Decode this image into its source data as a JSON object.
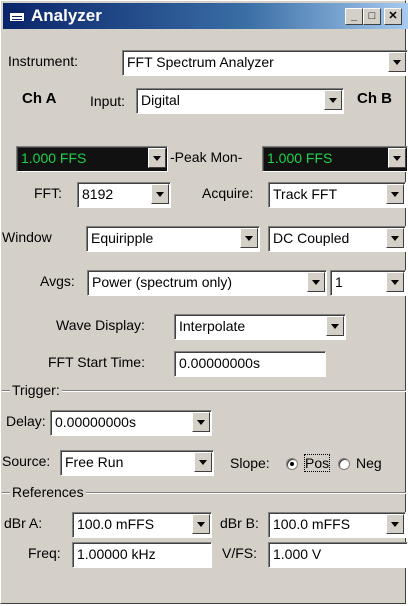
{
  "window": {
    "title": "Analyzer",
    "minimize": "_",
    "maximize": "□",
    "close": "✕"
  },
  "instrument": {
    "label": "Instrument:",
    "value": "FFT Spectrum Analyzer"
  },
  "channels": {
    "ch_a": "Ch A",
    "ch_b": "Ch B",
    "input_label": "Input:",
    "input_value": "Digital"
  },
  "peak": {
    "left_value": "1.000   FFS",
    "label": "-Peak Mon-",
    "right_value": "1.000   FFS"
  },
  "fft": {
    "label": "FFT:",
    "value": "8192",
    "acquire_label": "Acquire:",
    "acquire_value": "Track FFT"
  },
  "window_row": {
    "label": "Window",
    "value": "Equiripple",
    "coupling": "DC Coupled"
  },
  "avgs": {
    "label": "Avgs:",
    "value": "Power (spectrum only)",
    "count": "1"
  },
  "wave_display": {
    "label": "Wave Display:",
    "value": "Interpolate"
  },
  "fft_start": {
    "label": "FFT Start Time:",
    "value": "0.00000000s"
  },
  "trigger": {
    "group_label": "Trigger:",
    "delay_label": "Delay:",
    "delay_value": "0.00000000s",
    "source_label": "Source:",
    "source_value": "Free Run",
    "slope_label": "Slope:",
    "pos_label": "Pos",
    "neg_label": "Neg",
    "slope_selected": "Pos"
  },
  "references": {
    "group_label": "References",
    "dbr_a_label": "dBr A:",
    "dbr_a_value": "100.0   mFFS",
    "dbr_b_label": "dBr B:",
    "dbr_b_value": "100.0   mFFS",
    "freq_label": "Freq:",
    "freq_value": "1.00000 kHz",
    "vfs_label": "V/FS:",
    "vfs_value": "1.000    V"
  }
}
